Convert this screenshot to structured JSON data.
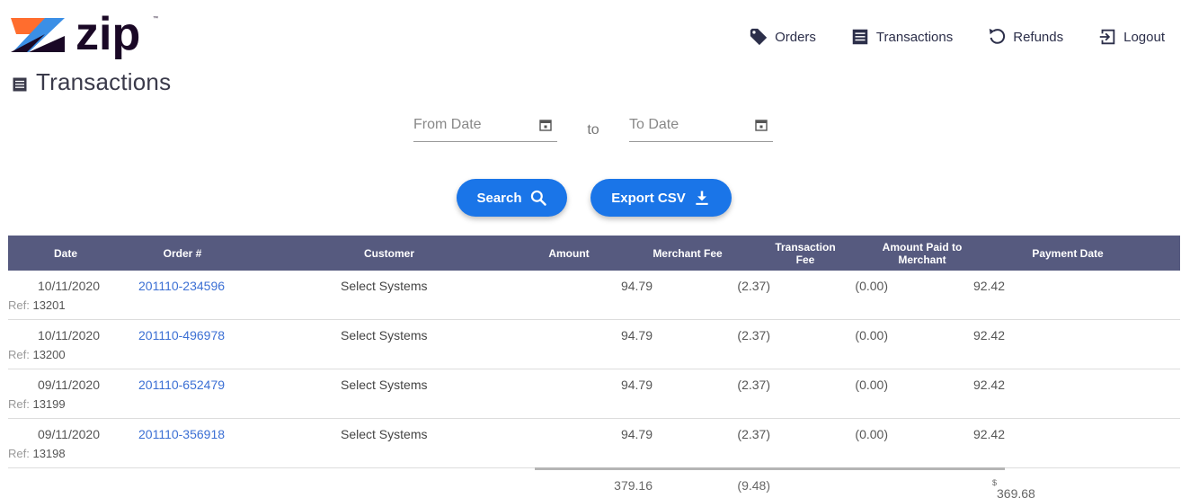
{
  "brand": {
    "name": "zip",
    "colors": {
      "purple": "#1a0826",
      "orange": "#ff6d2e",
      "blue": "#3b8fe6",
      "header": "#565a7f",
      "accent": "#1a75e8"
    }
  },
  "nav": [
    {
      "label": "Orders",
      "icon": "tag-icon"
    },
    {
      "label": "Transactions",
      "icon": "list-icon"
    },
    {
      "label": "Refunds",
      "icon": "undo-icon"
    },
    {
      "label": "Logout",
      "icon": "logout-icon"
    }
  ],
  "page": {
    "title": "Transactions"
  },
  "filters": {
    "from_placeholder": "From Date",
    "to_label": "to",
    "to_placeholder": "To Date"
  },
  "buttons": {
    "search": "Search",
    "export": "Export CSV"
  },
  "table": {
    "headers": [
      "Date",
      "Order #",
      "Customer",
      "Amount",
      "Merchant Fee",
      "Transaction Fee",
      "Amount Paid to Merchant",
      "Payment Date"
    ],
    "ref_label": "Ref:",
    "rows": [
      {
        "date": "10/11/2020",
        "ref": "13201",
        "order": "201110-234596",
        "customer": "Select Systems",
        "amount": "94.79",
        "merchant_fee": "(2.37)",
        "transaction_fee": "(0.00)",
        "paid": "92.42",
        "payment_date": ""
      },
      {
        "date": "10/11/2020",
        "ref": "13200",
        "order": "201110-496978",
        "customer": "Select Systems",
        "amount": "94.79",
        "merchant_fee": "(2.37)",
        "transaction_fee": "(0.00)",
        "paid": "92.42",
        "payment_date": ""
      },
      {
        "date": "09/11/2020",
        "ref": "13199",
        "order": "201110-652479",
        "customer": "Select Systems",
        "amount": "94.79",
        "merchant_fee": "(2.37)",
        "transaction_fee": "(0.00)",
        "paid": "92.42",
        "payment_date": ""
      },
      {
        "date": "09/11/2020",
        "ref": "13198",
        "order": "201110-356918",
        "customer": "Select Systems",
        "amount": "94.79",
        "merchant_fee": "(2.37)",
        "transaction_fee": "(0.00)",
        "paid": "92.42",
        "payment_date": ""
      }
    ],
    "totals": {
      "amount": "379.16",
      "merchant_fee": "(9.48)",
      "currency_symbol": "$",
      "paid": "369.68"
    }
  }
}
